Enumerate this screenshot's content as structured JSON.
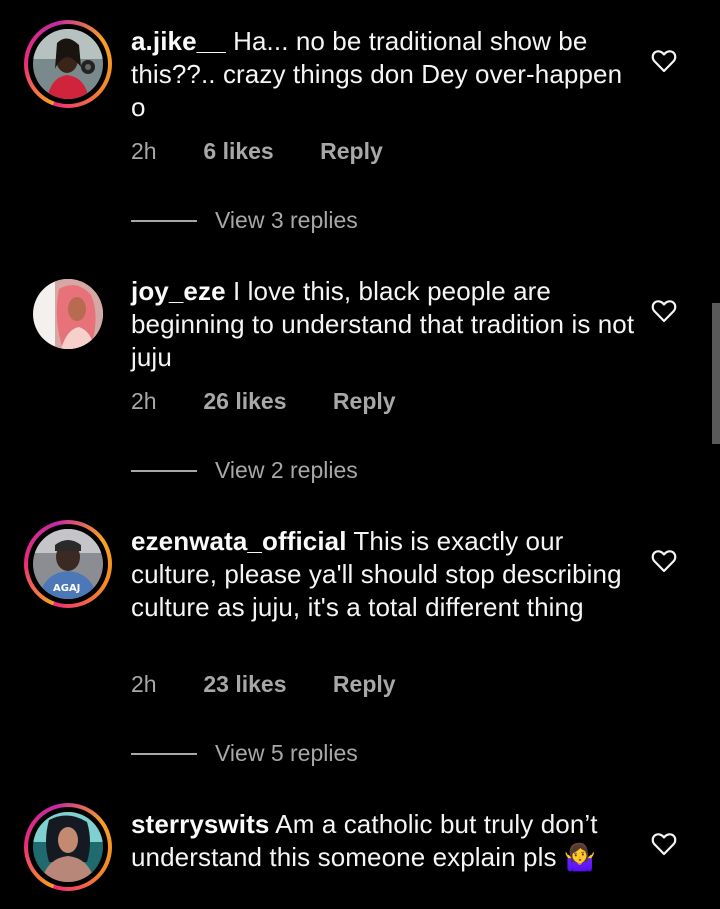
{
  "comments": [
    {
      "username": "a.jike__",
      "text": "Ha... no be traditional show be this??.. crazy things don Dey over-happen o",
      "time": "2h",
      "likes": "6 likes",
      "reply": "Reply",
      "view_replies": "View 3 replies",
      "avatar_icon": "profile-photo",
      "has_story_ring": true
    },
    {
      "username": "joy_eze",
      "text": "I love this, black people are beginning to understand that tradition is not juju",
      "time": "2h",
      "likes": "26 likes",
      "reply": "Reply",
      "view_replies": "View 2 replies",
      "avatar_icon": "profile-photo",
      "has_story_ring": false
    },
    {
      "username": "ezenwata_official",
      "text": "This is exactly our culture,  please ya'll should stop describing culture as juju, it's a total different thing",
      "time": "2h",
      "likes": "23 likes",
      "reply": "Reply",
      "view_replies": "View 5 replies",
      "avatar_icon": "profile-photo",
      "has_story_ring": true
    },
    {
      "username": "sterryswits",
      "text": "Am a catholic but truly don’t understand this someone explain pls",
      "emoji": "🤷‍♀️",
      "avatar_icon": "profile-photo",
      "has_story_ring": true
    }
  ],
  "icons": {
    "like": "heart-outline-icon"
  },
  "colors": {
    "background": "#000000",
    "text": "#f5f5f5",
    "secondary_text": "#a8a8a8"
  }
}
